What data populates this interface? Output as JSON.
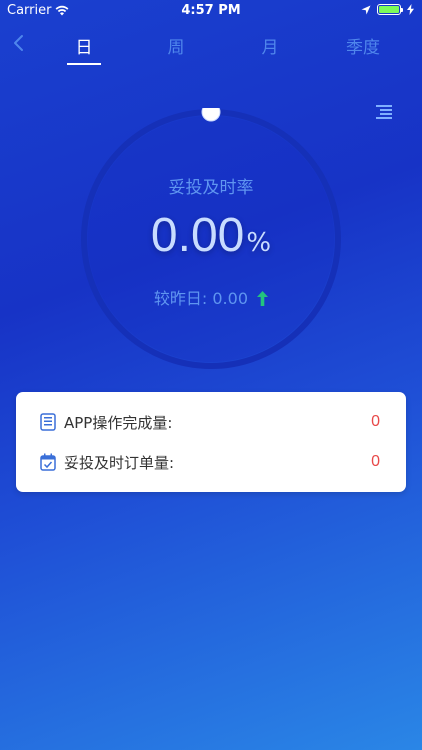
{
  "status_bar": {
    "carrier": "Carrier",
    "time": "4:57 PM"
  },
  "nav": {
    "tabs": [
      {
        "label": "日"
      },
      {
        "label": "周"
      },
      {
        "label": "月"
      },
      {
        "label": "季度"
      }
    ]
  },
  "gauge": {
    "title": "妥投及时率",
    "value": "0.00",
    "unit": "%",
    "compare_label": "较昨日: 0.00"
  },
  "stats": [
    {
      "label": "APP操作完成量:",
      "value": "0",
      "icon": "document-icon"
    },
    {
      "label": "妥投及时订单量:",
      "value": "0",
      "icon": "calendar-check-icon"
    }
  ],
  "colors": {
    "accent_light": "#5f95f0",
    "count_red": "#e84848",
    "trend_green": "#23c47e"
  }
}
